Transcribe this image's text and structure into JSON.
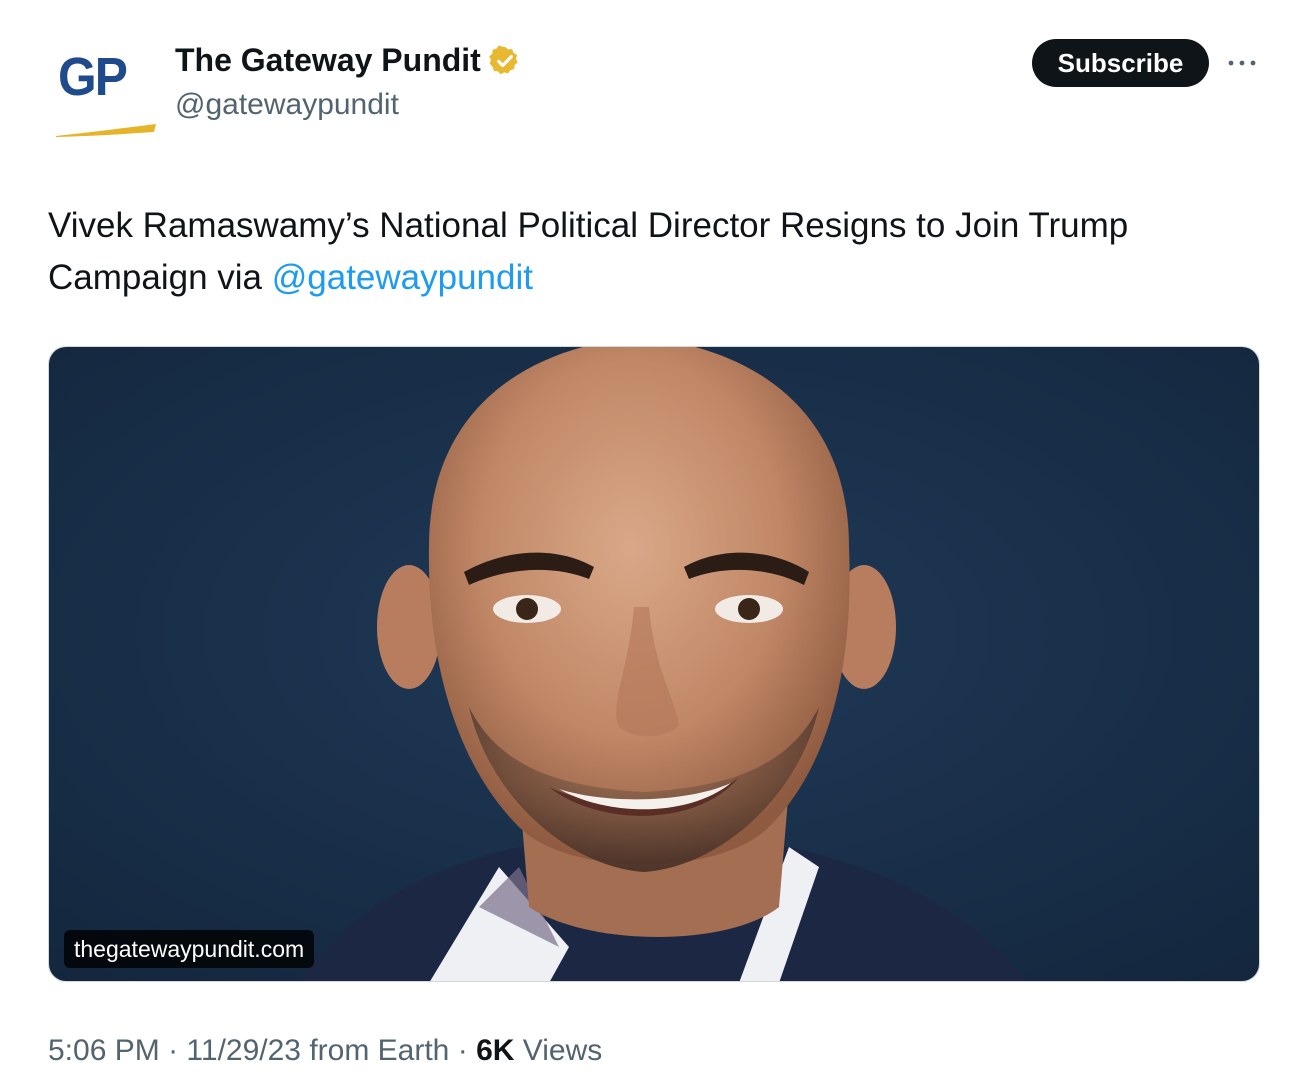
{
  "author": {
    "avatar_text": "GP",
    "display_name": "The Gateway Pundit",
    "handle": "@gatewaypundit",
    "verified_badge_icon": "verified-badge-icon",
    "badge_color": "#e8b830"
  },
  "actions": {
    "subscribe_label": "Subscribe",
    "more_icon": "more-horizontal-icon"
  },
  "tweet": {
    "text": "Vivek Ramaswamy’s National Political Director Resigns to Join Trump Campaign via ",
    "mention": "@gatewaypundit",
    "media_domain": "thegatewaypundit.com"
  },
  "meta": {
    "time": "5:06 PM",
    "date": "11/29/23",
    "location": "from Earth",
    "views_count": "6K",
    "views_label": "Views",
    "separator": "·"
  },
  "colors": {
    "accent_link": "#1d9bf0",
    "text_primary": "#0f1419",
    "text_secondary": "#536471",
    "brand_blue": "#1f4a8c",
    "brand_gold": "#e6b429"
  }
}
